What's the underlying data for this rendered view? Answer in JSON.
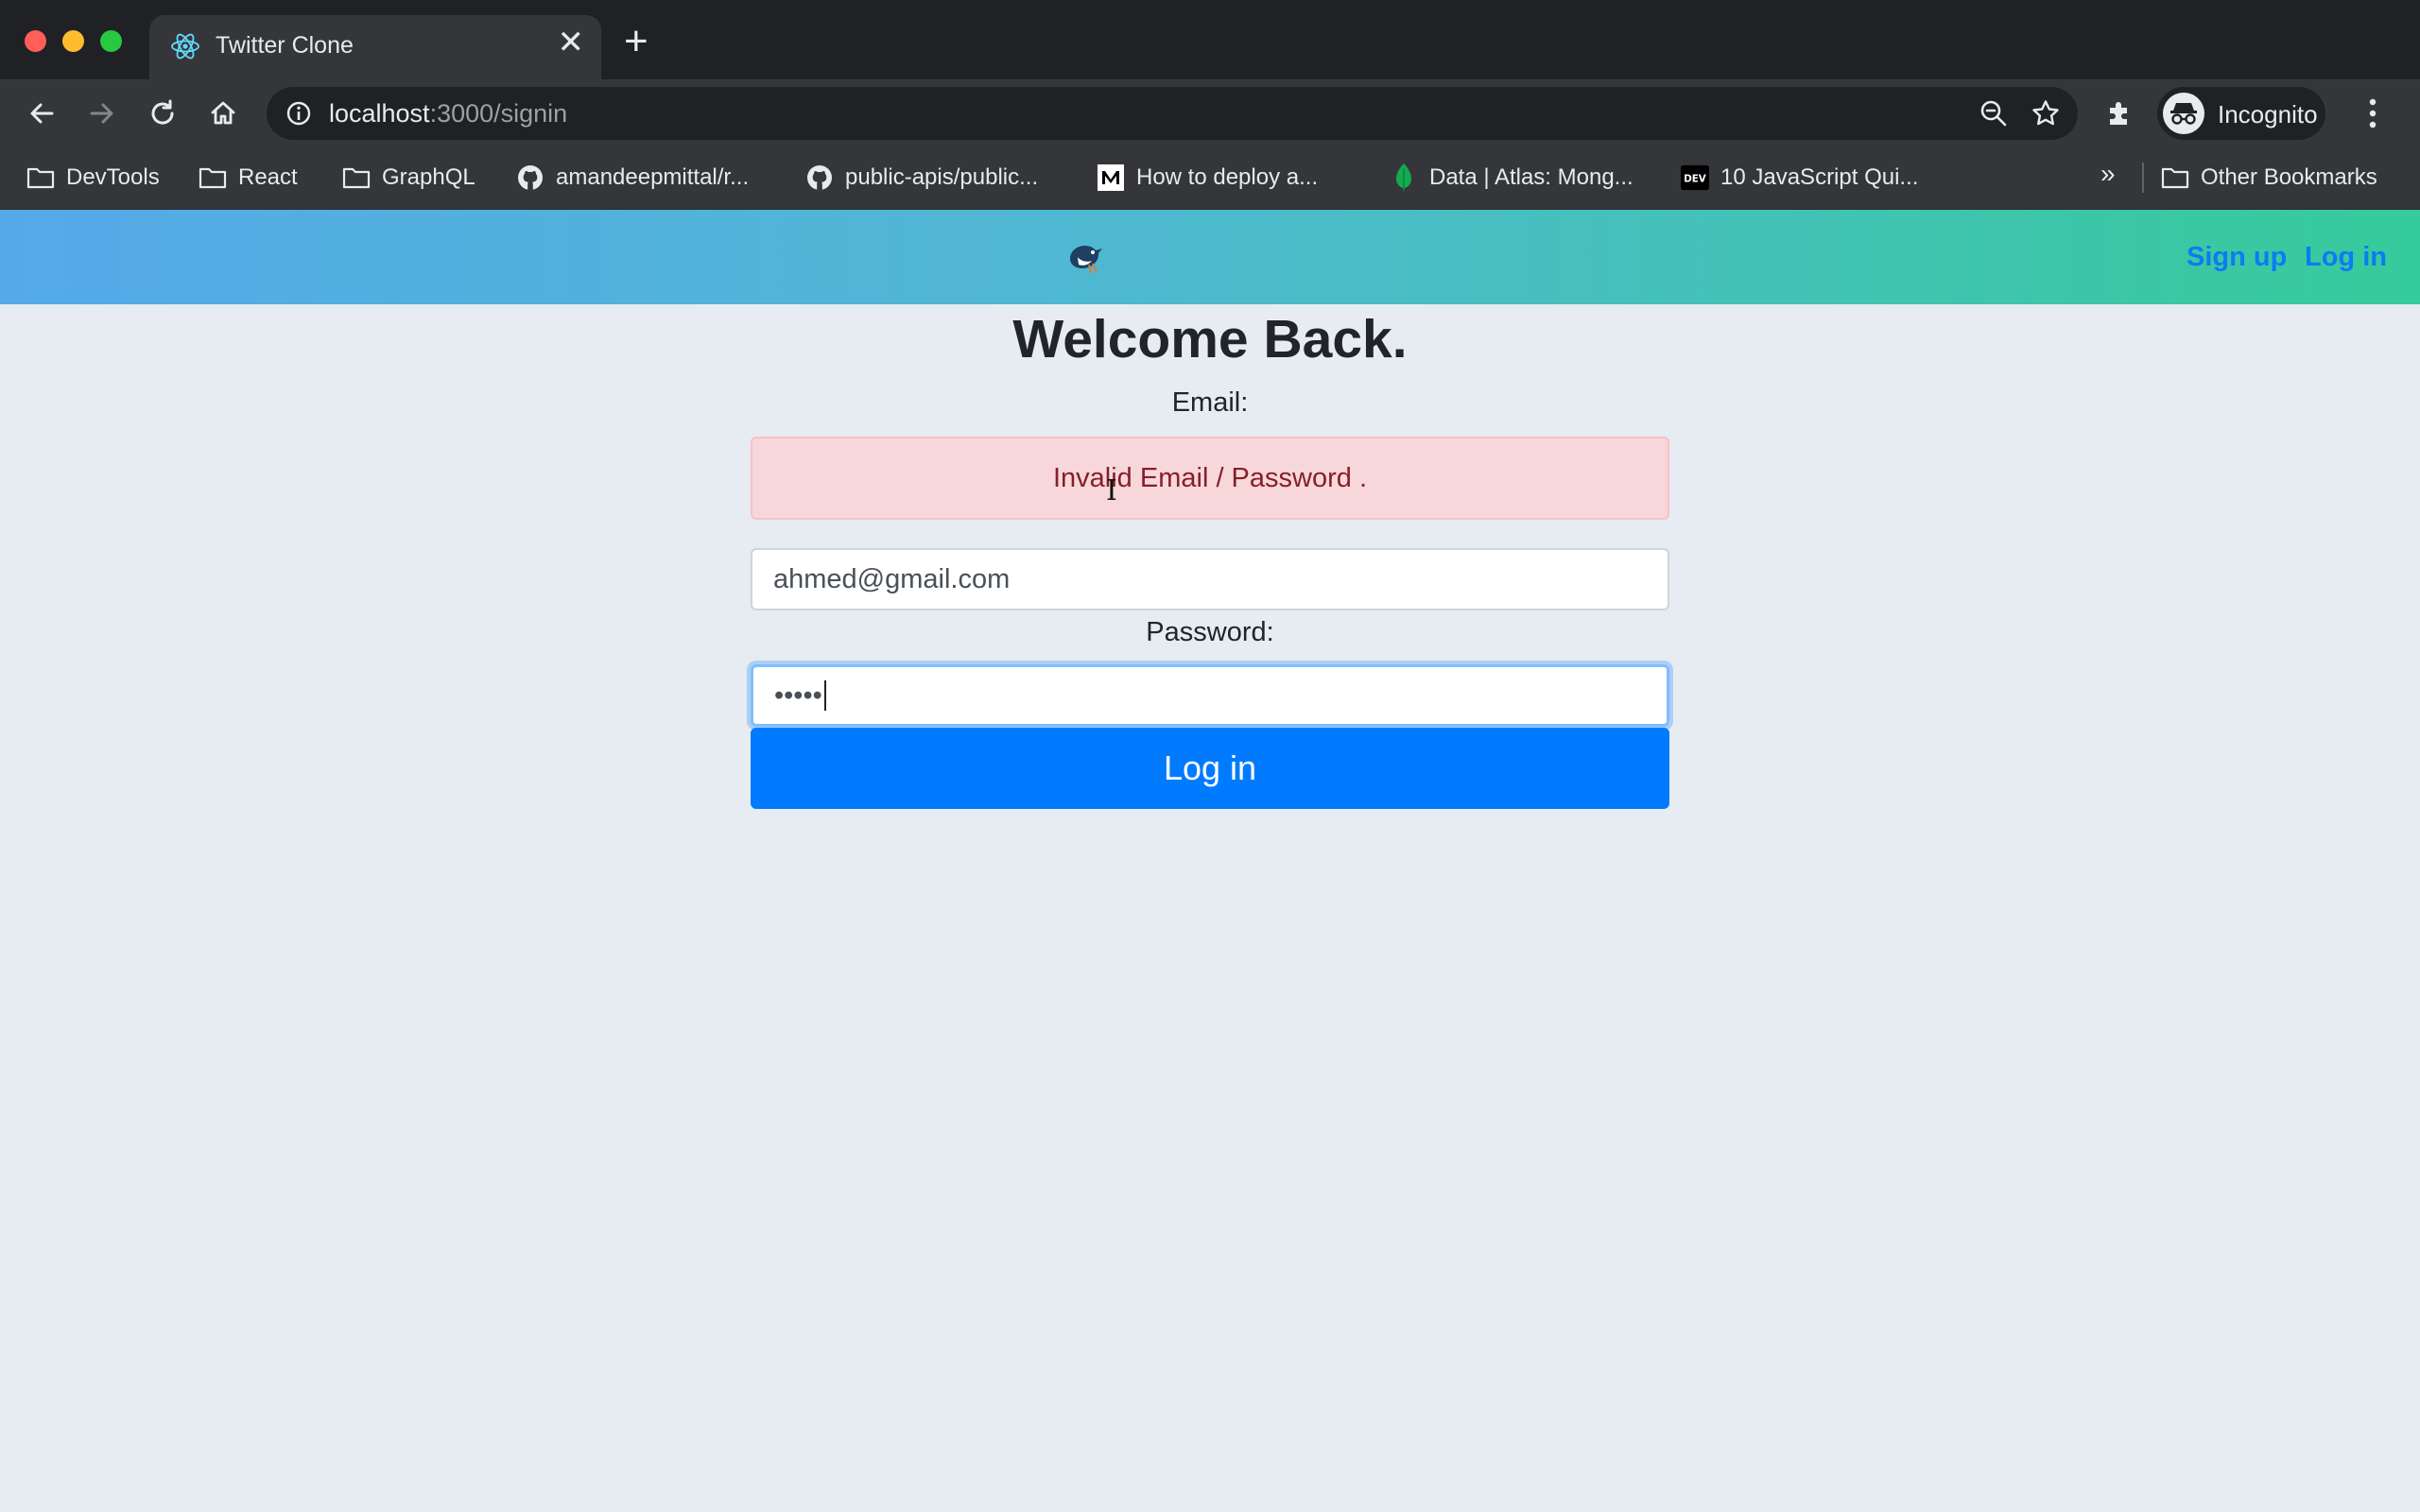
{
  "browser": {
    "tab": {
      "title": "Twitter Clone",
      "close_glyph": "✕",
      "favicon": "react-icon"
    },
    "new_tab_glyph": "+",
    "address": {
      "host": "localhost",
      "path": ":3000/signin"
    },
    "profile": {
      "label": "Incognito"
    },
    "bookmarks": [
      {
        "label": "DevTools",
        "icon": "folder-icon"
      },
      {
        "label": "React",
        "icon": "folder-icon"
      },
      {
        "label": "GraphQL",
        "icon": "folder-icon"
      },
      {
        "label": "amandeepmittal/r...",
        "icon": "github-icon"
      },
      {
        "label": "public-apis/public...",
        "icon": "github-icon"
      },
      {
        "label": "How to deploy a...",
        "icon": "medium-icon"
      },
      {
        "label": "Data | Atlas: Mong...",
        "icon": "mongodb-leaf-icon"
      },
      {
        "label": "10 JavaScript Qui...",
        "icon": "dev-icon"
      }
    ],
    "overflow_glyph": "»",
    "other_bookmarks": "Other Bookmarks"
  },
  "navbar": {
    "logo_icon": "bird-icon",
    "signup": "Sign up",
    "login": "Log in"
  },
  "form": {
    "heading": "Welcome Back.",
    "email_label": "Email:",
    "error": "Invalid Email / Password .",
    "email_value": "ahmed@gmail.com",
    "password_label": "Password:",
    "password_value": "•••••",
    "submit": "Log in"
  },
  "colors": {
    "navbar_gradient": [
      "#55a9e9",
      "#36cb9b"
    ],
    "link": "#0d7bf2",
    "primary_button": "#007bff",
    "alert_bg": "#f8d7da",
    "alert_text": "#842029",
    "page_bg": "#e6ecf1"
  }
}
